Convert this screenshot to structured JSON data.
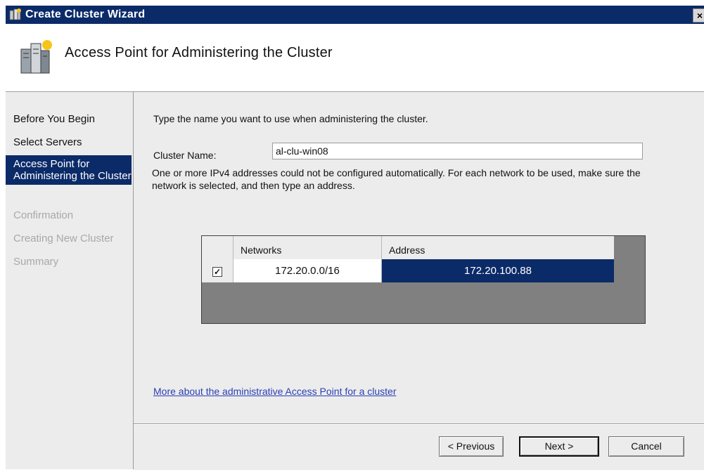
{
  "window": {
    "title": "Create Cluster Wizard",
    "close_label": "×"
  },
  "header": {
    "title": "Access Point for Administering the Cluster"
  },
  "steps": [
    {
      "label": "Before You Begin",
      "state": "done"
    },
    {
      "label": "Select Servers",
      "state": "done"
    },
    {
      "label": "Access Point for Administering the Cluster",
      "state": "active"
    },
    {
      "label": "Confirmation",
      "state": "disabled"
    },
    {
      "label": "Creating New Cluster",
      "state": "disabled"
    },
    {
      "label": "Summary",
      "state": "disabled"
    }
  ],
  "main": {
    "instruction": "Type the name you want to use when administering the cluster.",
    "cluster_name_label": "Cluster Name:",
    "cluster_name_value": "al-clu-win08",
    "warning": "One or more IPv4 addresses could not be configured automatically.  For each network to be used, make sure the network is selected, and then type an address.",
    "grid": {
      "columns": [
        "",
        "Networks",
        "Address"
      ],
      "rows": [
        {
          "checked": true,
          "network": "172.20.0.0/16",
          "address": "172.20.100.88"
        }
      ]
    },
    "more_link": "More about the administrative Access Point for a cluster"
  },
  "buttons": {
    "previous": "< Previous",
    "next": "Next >",
    "cancel": "Cancel"
  },
  "colors": {
    "title_bar": "#0b2a68",
    "selection": "#0b2a68",
    "panel": "#ececec",
    "link": "#2a3fb5"
  }
}
